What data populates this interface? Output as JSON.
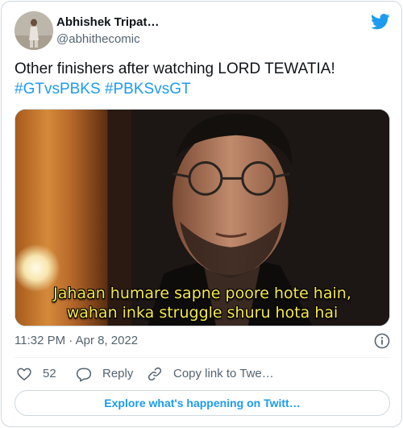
{
  "author": {
    "display_name": "Abhishek Tripat…",
    "handle": "@abhithecomic"
  },
  "tweet": {
    "text": "Other finishers after watching LORD TEWATIA!",
    "hashtags": [
      "#GTvsPBKS",
      "#PBKSvsGT"
    ]
  },
  "media": {
    "subtitle_line1": "Jahaan humare sapne poore hote hain,",
    "subtitle_line2": "wahan inka struggle shuru hota hai"
  },
  "meta": {
    "timestamp": "11:32 PM · Apr 8, 2022"
  },
  "actions": {
    "like_count": "52",
    "reply_label": "Reply",
    "copy_label": "Copy link to Twe…"
  },
  "footer": {
    "explore_label": "Explore what's happening on Twitt…"
  },
  "colors": {
    "accent": "#1d9bf0",
    "text_primary": "#0f1419",
    "text_secondary": "#536471",
    "border": "#cfd9de",
    "subtitle": "#f6e84a"
  },
  "icons": [
    "twitter-bird-icon",
    "info-icon",
    "heart-icon",
    "reply-icon",
    "link-icon"
  ]
}
